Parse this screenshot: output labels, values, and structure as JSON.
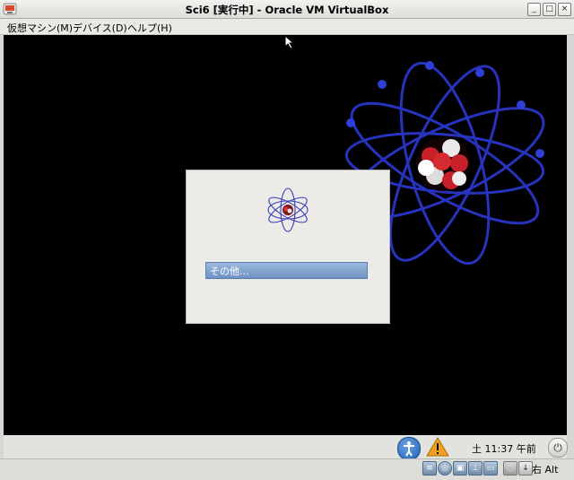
{
  "window": {
    "title": "Sci6 [実行中] - Oracle VM VirtualBox",
    "buttons": [
      "_",
      "□",
      "×"
    ]
  },
  "menubar": {
    "items": [
      "仮想マシン(M)",
      "デバイス(D)",
      "ヘルプ(H)"
    ]
  },
  "login": {
    "user_option": "その他..."
  },
  "guest_panel": {
    "clock": "土 11:37 午前"
  },
  "statusbar": {
    "host_key": "右 Alt",
    "icons": [
      "hard-disk-icon",
      "optical-drive-icon",
      "network-icon",
      "usb-icon",
      "shared-folder-icon",
      "capture-icon",
      "mouse-integration-icon",
      "keyboard-capture-icon"
    ]
  },
  "colors": {
    "vm_background": "#000000",
    "orbit_blue": "#2a35c8",
    "selection_blue": "#7d9dd0"
  }
}
